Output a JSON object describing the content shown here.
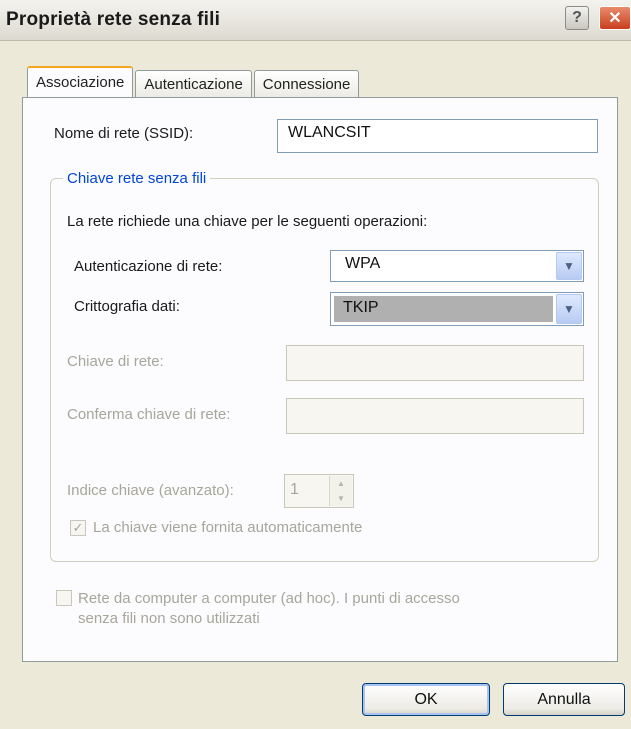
{
  "window": {
    "title": "Proprietà rete senza fili",
    "help_label": "?",
    "close_label": "✕"
  },
  "tabs": [
    {
      "label": "Associazione",
      "active": true
    },
    {
      "label": "Autenticazione",
      "active": false
    },
    {
      "label": "Connessione",
      "active": false
    }
  ],
  "ssid": {
    "label": "Nome di rete (SSID):",
    "value": "WLANCSIT"
  },
  "group": {
    "legend": "Chiave rete senza fili",
    "description": "La rete richiede una chiave per le seguenti operazioni:",
    "auth": {
      "label": "Autenticazione di rete:",
      "value": "WPA"
    },
    "encryption": {
      "label": "Crittografia dati:",
      "value": "TKIP"
    },
    "network_key": {
      "label": "Chiave di rete:",
      "value": ""
    },
    "confirm_key": {
      "label": "Conferma chiave di rete:",
      "value": ""
    },
    "key_index": {
      "label": "Indice chiave (avanzato):",
      "value": "1"
    },
    "auto_key": {
      "label": "La chiave viene fornita automaticamente",
      "checked": true
    }
  },
  "adhoc": {
    "line1": "Rete da computer a computer (ad hoc). I punti di accesso",
    "line2": "senza fili non sono utilizzati",
    "checked": false
  },
  "buttons": {
    "ok": "OK",
    "cancel": "Annulla"
  }
}
